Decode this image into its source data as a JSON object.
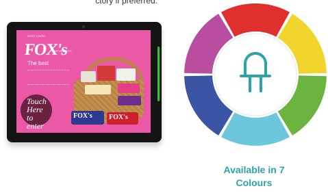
{
  "intro_text": "ctory if preferred.",
  "tablet": {
    "brand_small": "MOST LOVED",
    "brand": "FOX's",
    "brand_tag": "WE'VE GOT IT",
    "subtitle": "The best",
    "touch_text": "Touch Here to enter",
    "pack_label_1": "FOX's",
    "pack_label_2": "FOX's"
  },
  "wheel": {
    "icon": "led-bulb-icon",
    "segment_colors": [
      "#e0302e",
      "#f2d52c",
      "#6ab43f",
      "#6dc7dc",
      "#3c54a4",
      "#b94ea1"
    ],
    "center_color": "#2aa4a8"
  },
  "caption": {
    "line1": "Available in 7",
    "line2": "Colours"
  }
}
